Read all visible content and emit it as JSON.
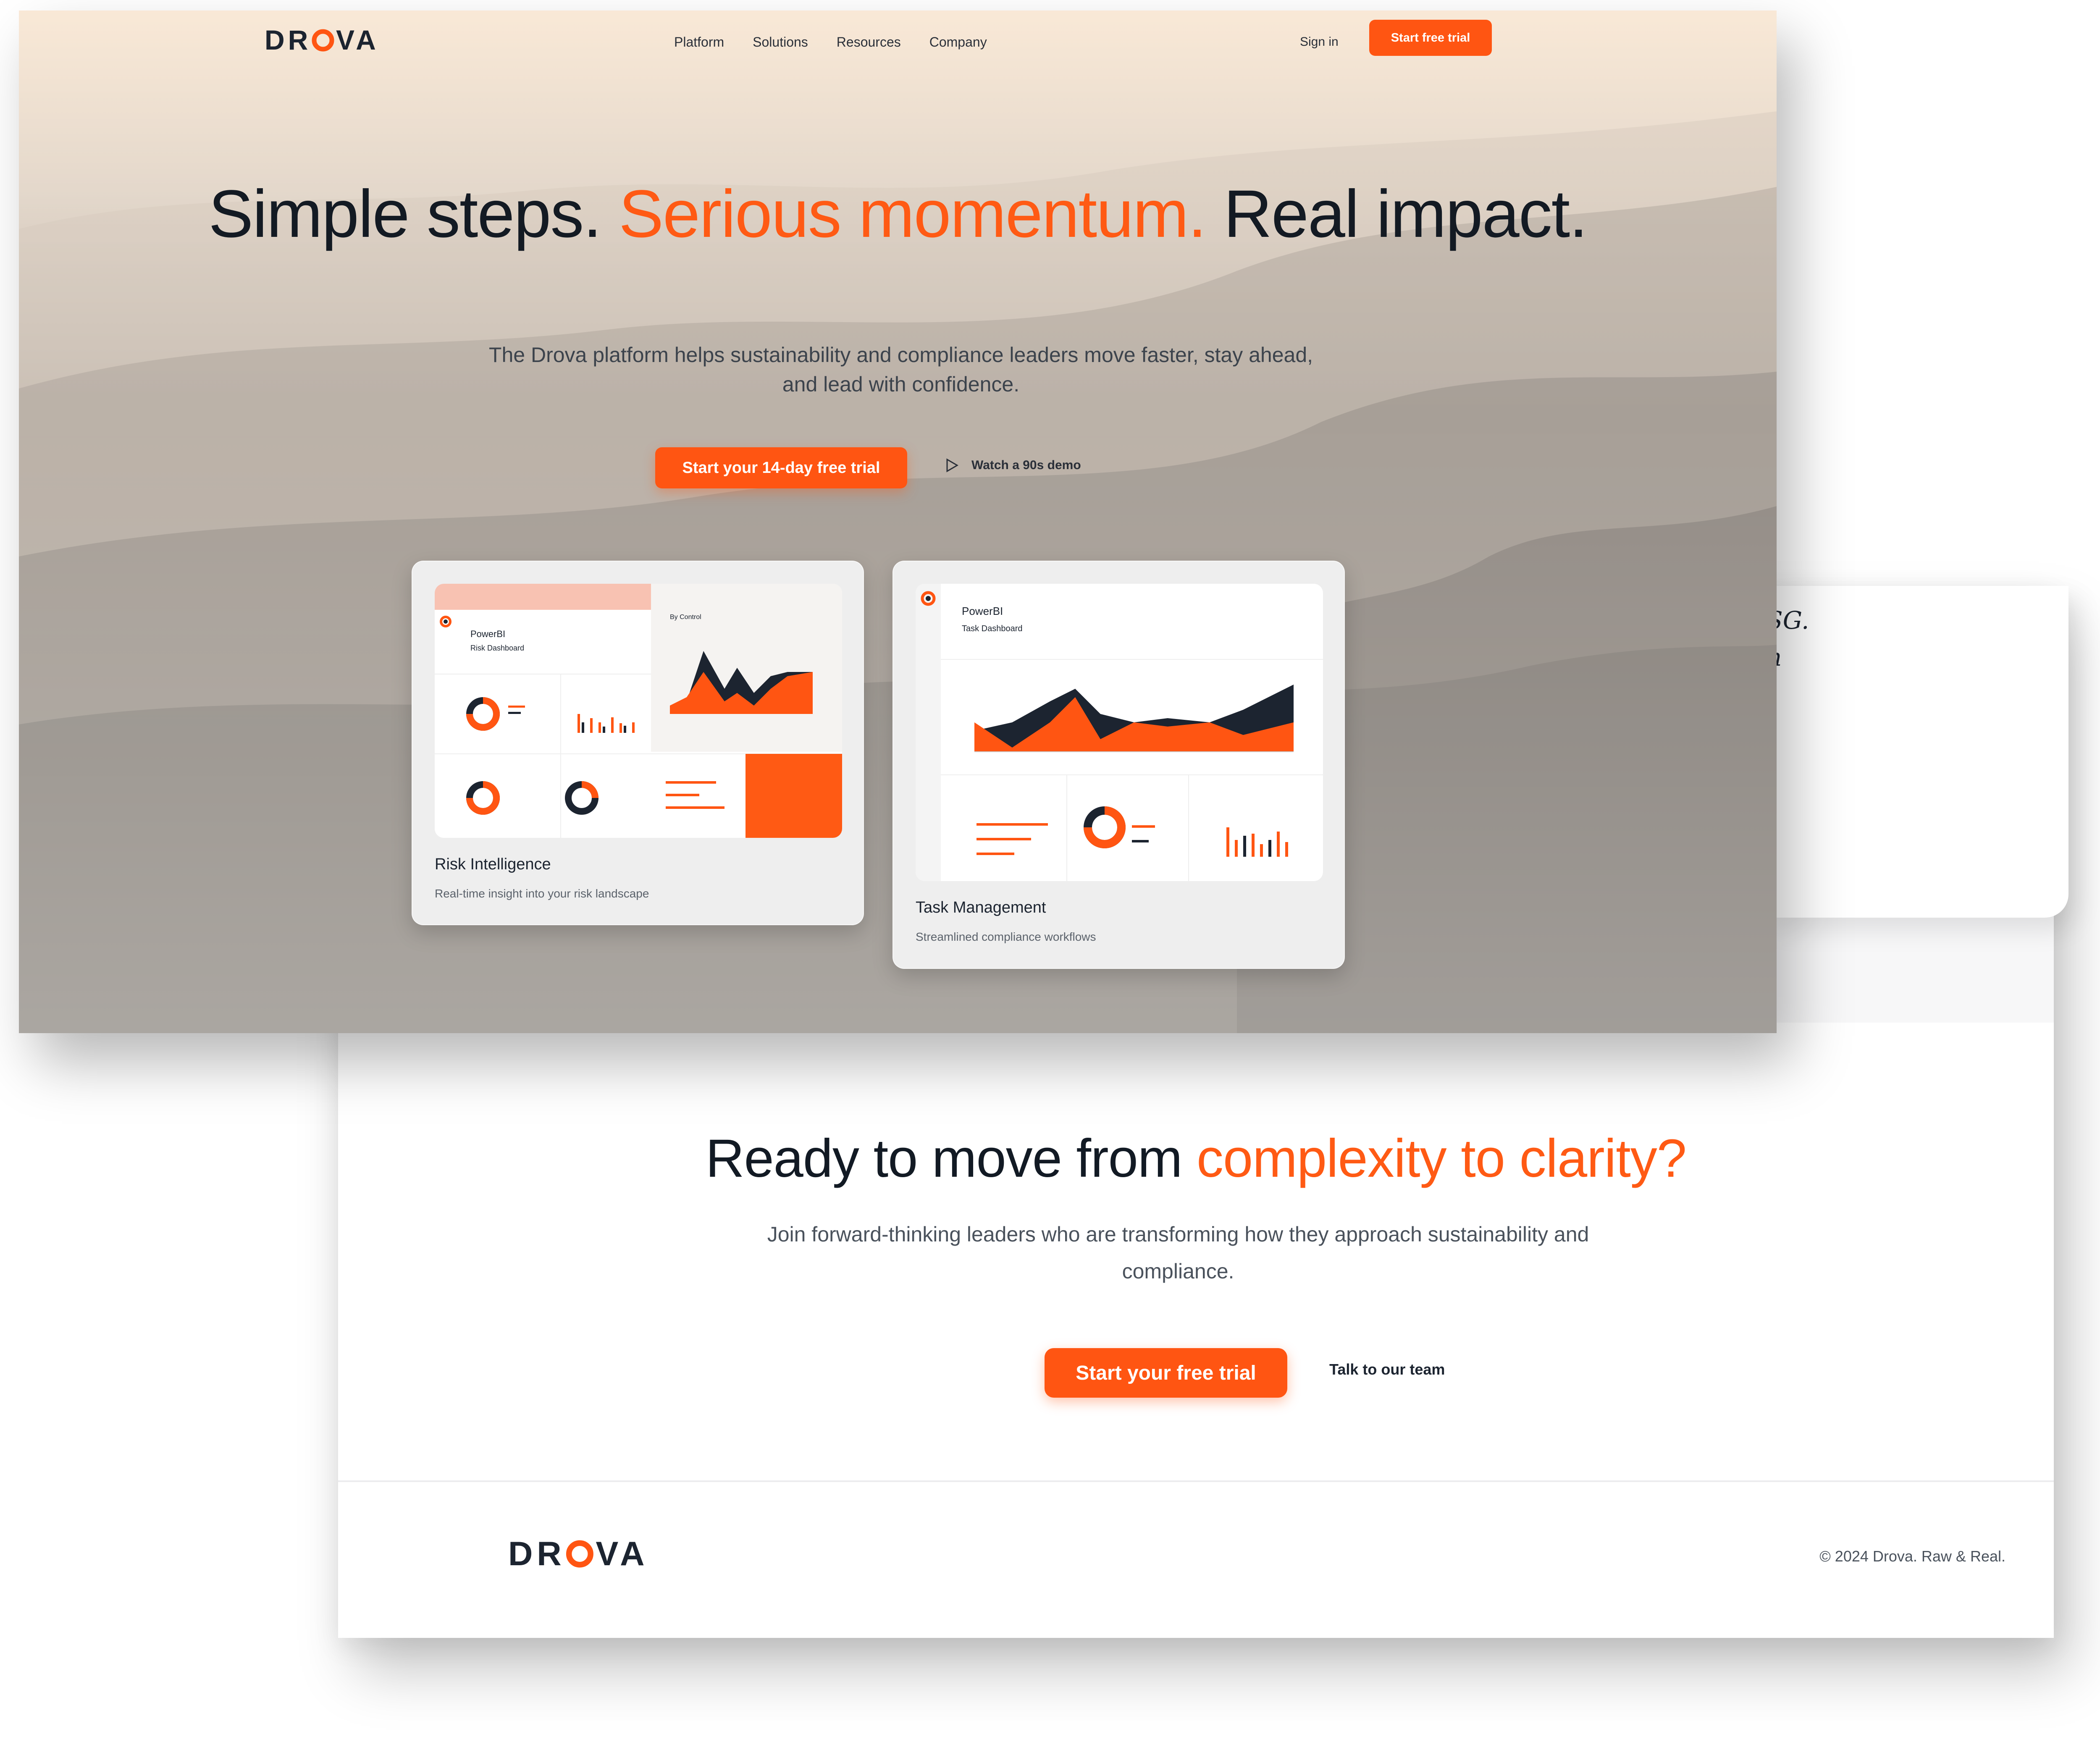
{
  "brand": {
    "name": "DROVA",
    "accent_color": "#ff5512",
    "dark_color": "#1c2430"
  },
  "nav": {
    "links": [
      "Platform",
      "Solutions",
      "Resources",
      "Company"
    ],
    "signin": "Sign in",
    "cta": "Start free trial"
  },
  "hero": {
    "title_part1": "Simple steps. ",
    "title_accent": "Serious momentum.",
    "title_part2": " Real impact.",
    "subtitle": "The Drova platform helps sustainability and compliance leaders move faster, stay ahead, and lead with confidence.",
    "primary_cta": "Start your 14-day free trial",
    "demo_link": "Watch a 90s demo",
    "demo_icon": "play-icon"
  },
  "cards": [
    {
      "title": "Risk Intelligence",
      "description": "Real-time insight into your risk landscape",
      "screenshot_app": "PowerBI",
      "screenshot_name": "Risk Dashboard",
      "chart_label": "By Control"
    },
    {
      "title": "Task Management",
      "description": "Streamlined compliance workflows",
      "screenshot_app": "PowerBI",
      "screenshot_name": "Task Dashboard"
    }
  ],
  "back_peek_text": "SG.\nn",
  "cta": {
    "title_part1": "Ready to move from ",
    "title_accent": "complexity to clarity?",
    "subtitle": "Join forward-thinking leaders who are transforming how they approach sustainability and compliance.",
    "primary": "Start your free trial",
    "secondary": "Talk to our team"
  },
  "footer": {
    "copyright": "© 2024 Drova. Raw & Real."
  }
}
